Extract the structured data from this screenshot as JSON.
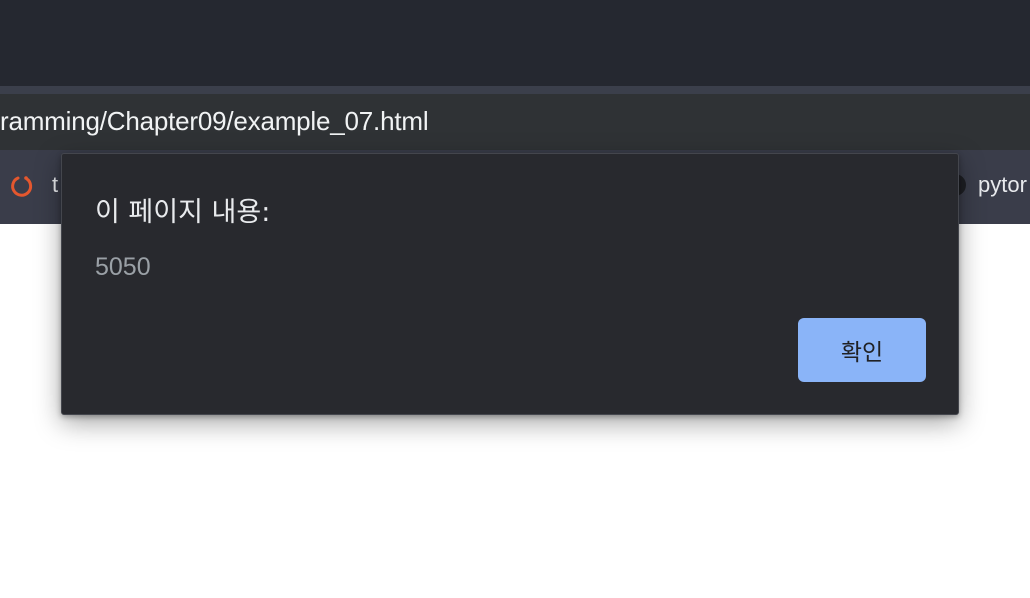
{
  "browser": {
    "address_bar": {
      "url_text": "ramming/Chapter09/example_07.html"
    },
    "bookmarks": [
      {
        "label": "t",
        "icon": "pytorch-icon"
      },
      {
        "label": "pytor",
        "icon": "github-icon"
      }
    ]
  },
  "dialog": {
    "title": "이 페이지 내용:",
    "message": "5050",
    "ok_label": "확인"
  },
  "colors": {
    "accent": "#8ab4f8",
    "dialog_bg": "#28292e",
    "toolbar_bg": "#252830"
  }
}
